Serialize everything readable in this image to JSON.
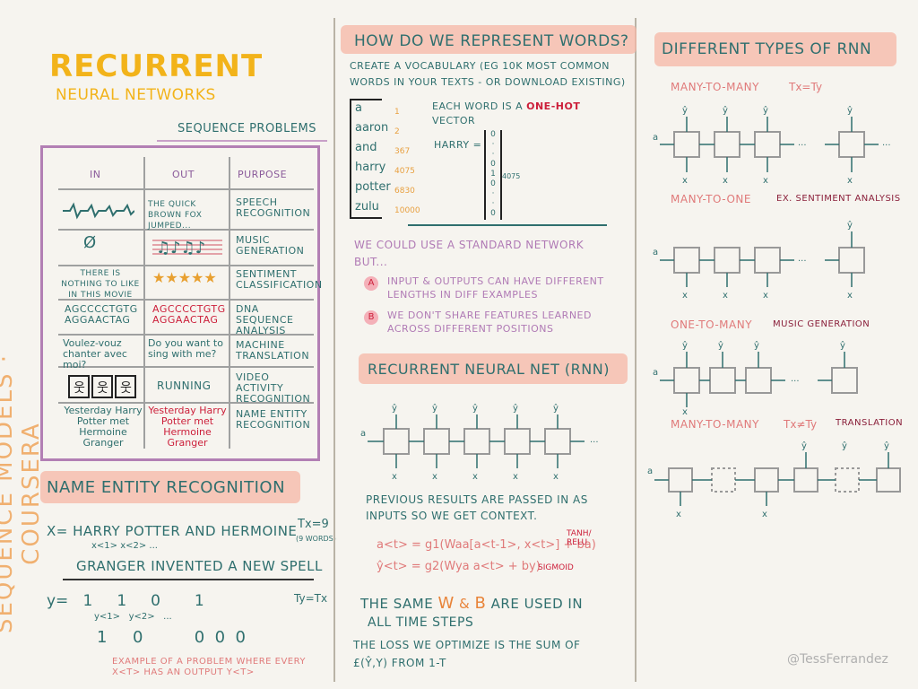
{
  "title": {
    "main": "RECURRENT",
    "sub": "NEURAL NETWORKS"
  },
  "side_text": "SEQUENCE MODELS · COURSERA",
  "credit": "@TessFerrandez",
  "sequence_problems": {
    "heading": "SEQUENCE PROBLEMS",
    "headers": [
      "IN",
      "OUT",
      "PURPOSE"
    ],
    "rows": [
      {
        "in": "",
        "out": "THE QUICK BROWN FOX JUMPED...",
        "purpose": "SPEECH RECOGNITION"
      },
      {
        "in": "Ø",
        "out": "",
        "purpose": "MUSIC GENERATION"
      },
      {
        "in": "THERE IS NOTHING TO LIKE IN THIS MOVIE",
        "out": "★★★★★",
        "purpose": "SENTIMENT CLASSIFICATION"
      },
      {
        "in": "AGCCCCTGTG AGGAACTAG",
        "out": "AGCCCCTGTG AGGAACTAG",
        "purpose": "DNA SEQUENCE ANALYSIS"
      },
      {
        "in": "Voulez-vouz chanter avec moi?",
        "out": "Do you want to sing with me?",
        "purpose": "MACHINE TRANSLATION"
      },
      {
        "in": "",
        "out": "RUNNING",
        "purpose": "VIDEO ACTIVITY RECOGNITION"
      },
      {
        "in": "Yesterday Harry Potter met Hermoine Granger",
        "out": "Yesterday Harry Potter met Hermoine Granger",
        "purpose": "NAME ENTITY RECOGNITION"
      }
    ]
  },
  "ner": {
    "heading": "NAME ENTITY RECOGNITION",
    "x_line": "X= HARRY POTTER AND HERMOINE",
    "tx": "Tx=9",
    "tx_note": "(9 WORDS)",
    "x_sub": "x<1>   x<2>   ...",
    "line2": "GRANGER INVENTED A NEW SPELL",
    "y_line": "y=   1     1     0       1",
    "ty": "Ty=Tx",
    "y_sub": "y<1>   y<2>   ...",
    "y_line2": "1     0          0  0  0",
    "note": "EXAMPLE OF A PROBLEM WHERE EVERY x<t> HAS AN OUTPUT y<t>"
  },
  "represent": {
    "heading": "HOW DO WE REPRESENT WORDS?",
    "vocab_line1": "CREATE A VOCABULARY (EG 10K MOST COMMON",
    "vocab_line2": "WORDS IN YOUR TEXTS - OR DOWNLOAD EXISTING)",
    "vocab": [
      "a",
      "aaron",
      "and",
      "harry",
      "potter",
      "zulu"
    ],
    "indices": [
      "1",
      "2",
      "367",
      "4075",
      "6830",
      "10000"
    ],
    "each_word": "EACH WORD IS A",
    "one_hot": "ONE-HOT",
    "vector": "VECTOR",
    "harry": "HARRY =",
    "pos": "4075",
    "standard_line1": "WE COULD USE A STANDARD NETWORK",
    "standard_line2": "BUT...",
    "reason_a": "INPUT & OUTPUTS CAN HAVE DIFFERENT LENGTHS IN DIFF EXAMPLES",
    "reason_b": "WE DON'T SHARE FEATURES LEARNED ACROSS DIFFERENT POSITIONS"
  },
  "rnn": {
    "heading": "RECURRENT NEURAL NET (RNN)",
    "desc": "PREVIOUS RESULTS ARE PASSED IN AS INPUTS SO WE GET CONTEXT.",
    "eq1": "a<t> = g1(Waa[a<t-1>, x<t>] + ba)",
    "eq1_note": "TANH/ RELU",
    "eq2": "ŷ<t> = g2(Wya a<t> + by)",
    "eq2_note": "SIGMOID",
    "same": "THE SAME",
    "w": "W",
    "and": "&",
    "b": "b",
    "same2": "ARE USED IN",
    "all_steps": "ALL TIME STEPS",
    "loss1": "THE LOSS WE OPTIMIZE IS THE SUM OF",
    "loss2": "£(ŷ,y) FROM 1-T"
  },
  "types": {
    "heading": "DIFFERENT TYPES OF RNN",
    "m2m": "MANY-TO-MANY",
    "m2m_eq": "Tx=Ty",
    "m2o": "MANY-TO-ONE",
    "m2o_ex": "EX. SENTIMENT ANALYSIS",
    "o2m": "ONE-TO-MANY",
    "o2m_ex": "MUSIC GENERATION",
    "m2m2": "MANY-TO-MANY",
    "m2m2_eq": "Tx≠Ty",
    "m2m2_ex": "TRANSLATION"
  },
  "colors": {
    "teal": "#2f6f6e",
    "pink": "#e07a7a",
    "purple": "#8a5a9a",
    "red": "#cc1f3a",
    "orange": "#e8843a",
    "yellow": "#f2b31a"
  }
}
